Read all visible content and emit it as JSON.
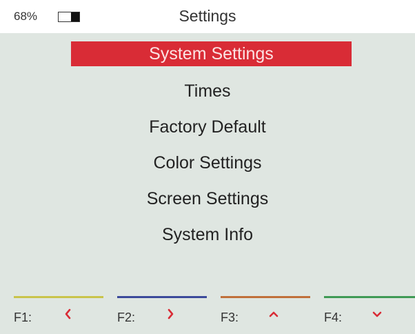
{
  "topbar": {
    "battery_percent_label": "68%",
    "battery_level": 0.68,
    "title": "Settings"
  },
  "menu": {
    "items": [
      {
        "label": "System Settings",
        "selected": true
      },
      {
        "label": "Times",
        "selected": false
      },
      {
        "label": "Factory Default",
        "selected": false
      },
      {
        "label": "Color Settings",
        "selected": false
      },
      {
        "label": "Screen Settings",
        "selected": false
      },
      {
        "label": "System Info",
        "selected": false
      }
    ],
    "selected_color": "#d92c36"
  },
  "footer": {
    "keys": [
      {
        "label": "F1:",
        "icon": "chevron-left-icon",
        "color": "#c9c34a"
      },
      {
        "label": "F2:",
        "icon": "chevron-right-icon",
        "color": "#3b4a9a"
      },
      {
        "label": "F3:",
        "icon": "chevron-up-icon",
        "color": "#c0703a"
      },
      {
        "label": "F4:",
        "icon": "chevron-down-icon",
        "color": "#3f9a55"
      }
    ],
    "arrow_color": "#d92c36"
  }
}
